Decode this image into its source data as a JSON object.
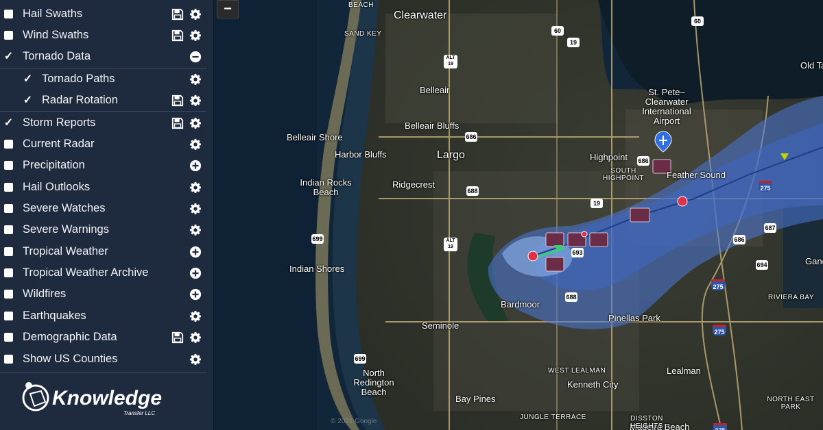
{
  "sidebar": {
    "layers": [
      {
        "label": "Hail Swaths",
        "checked": false,
        "actions": [
          "save",
          "gear"
        ]
      },
      {
        "label": "Wind Swaths",
        "checked": false,
        "actions": [
          "save",
          "gear"
        ]
      },
      {
        "label": "Tornado Data",
        "checked": true,
        "actions": [
          "minus"
        ]
      },
      {
        "label": "Tornado Paths",
        "checked": true,
        "actions": [
          "gear"
        ],
        "sub": true
      },
      {
        "label": "Radar Rotation",
        "checked": true,
        "actions": [
          "save",
          "gear"
        ],
        "sub": true
      },
      {
        "label": "Storm Reports",
        "checked": true,
        "actions": [
          "save",
          "gear"
        ]
      },
      {
        "label": "Current Radar",
        "checked": false,
        "actions": [
          "gear"
        ]
      },
      {
        "label": "Precipitation",
        "checked": false,
        "actions": [
          "plus"
        ]
      },
      {
        "label": "Hail Outlooks",
        "checked": false,
        "actions": [
          "gear"
        ]
      },
      {
        "label": "Severe Watches",
        "checked": false,
        "actions": [
          "gear"
        ]
      },
      {
        "label": "Severe Warnings",
        "checked": false,
        "actions": [
          "gear"
        ]
      },
      {
        "label": "Tropical Weather",
        "checked": false,
        "actions": [
          "plus"
        ]
      },
      {
        "label": "Tropical Weather Archive",
        "checked": false,
        "actions": [
          "plus"
        ]
      },
      {
        "label": "Wildfires",
        "checked": false,
        "actions": [
          "plus"
        ]
      },
      {
        "label": "Earthquakes",
        "checked": false,
        "actions": [
          "gear"
        ]
      },
      {
        "label": "Demographic Data",
        "checked": false,
        "actions": [
          "save",
          "gear"
        ]
      },
      {
        "label": "Show US Counties",
        "checked": false,
        "actions": [
          "gear"
        ]
      }
    ],
    "logo": {
      "name": "Knowledge",
      "tagline": "Transfer LLC"
    }
  },
  "map": {
    "zoom_out_label": "−",
    "copyright": "© 2021 Google",
    "place_labels": [
      "Clearwater",
      "Belleair",
      "Belleair Bluffs",
      "Belleair Shore",
      "Harbor Bluffs",
      "Largo",
      "Ridgecrest",
      "Indian Rocks Beach",
      "Indian Shores",
      "Highpoint",
      "Feather Sound",
      "Bardmoor",
      "Seminole",
      "Pinellas Park",
      "North Redington Beach",
      "Bay Pines",
      "Kenneth City",
      "Lealman",
      "Gandy",
      "Madeira Beach",
      "Old Tampa",
      "St. Pete–Clearwater International Airport"
    ],
    "small_labels": [
      "BEACH",
      "SAND KEY",
      "SOUTH HIGHPOINT",
      "WEST LEALMAN",
      "JUNGLE TERRACE",
      "DISSTON HEIGHTS",
      "RIVIERA BAY",
      "NORTH EAST PARK"
    ],
    "route_shields": [
      "60",
      "60",
      "19",
      "ALT 19",
      "ALT 19",
      "686",
      "686",
      "688",
      "688",
      "19",
      "699",
      "699",
      "693",
      "694",
      "687",
      "686"
    ],
    "interstate_shields": [
      "275",
      "275",
      "275",
      "275"
    ],
    "colors": {
      "swath_outer": "#4a78d8",
      "swath_inner": "#6f9ee6",
      "track": "#1f3d8a",
      "report_marker": "#e0304a",
      "rotation_marker": "#6a2c46",
      "airport_pin": "#2f6fe0"
    }
  }
}
